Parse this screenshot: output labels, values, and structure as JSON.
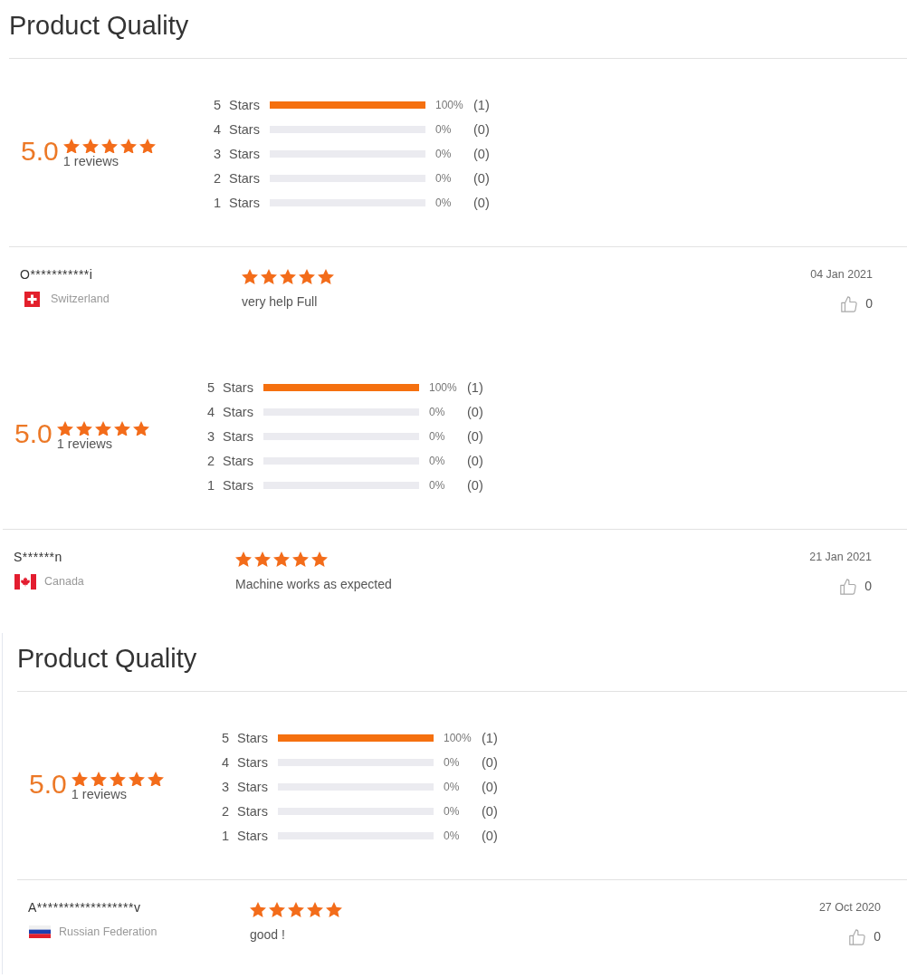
{
  "sections": [
    {
      "title": "Product Quality",
      "summary": {
        "score": "5.0",
        "stars": 5,
        "review_count": "1 reviews",
        "distribution": [
          {
            "label": "5 Stars",
            "level": 1,
            "percent": "100%",
            "count": "(1)"
          },
          {
            "label": "4 Stars",
            "level": 0,
            "percent": "0%",
            "count": "(0)"
          },
          {
            "label": "3 Stars",
            "level": 0,
            "percent": "0%",
            "count": "(0)"
          },
          {
            "label": "2 Stars",
            "level": 0,
            "percent": "0%",
            "count": "(0)"
          },
          {
            "label": "1 Stars",
            "level": 0,
            "percent": "0%",
            "count": "(0)"
          }
        ]
      },
      "reviews": [
        {
          "name": "O***********i",
          "flag": {
            "kind": "ch"
          },
          "country": "Switzerland",
          "stars": 5,
          "text": "very help Full",
          "date": "04 Jan 2021",
          "likes": "0"
        }
      ]
    },
    {
      "summary": {
        "score": "5.0",
        "stars": 5,
        "review_count": "1 reviews",
        "distribution": [
          {
            "label": "5 Stars",
            "level": 1,
            "percent": "100%",
            "count": "(1)"
          },
          {
            "label": "4 Stars",
            "level": 0,
            "percent": "0%",
            "count": "(0)"
          },
          {
            "label": "3 Stars",
            "level": 0,
            "percent": "0%",
            "count": "(0)"
          },
          {
            "label": "2 Stars",
            "level": 0,
            "percent": "0%",
            "count": "(0)"
          },
          {
            "label": "1 Stars",
            "level": 0,
            "percent": "0%",
            "count": "(0)"
          }
        ]
      },
      "reviews": [
        {
          "name": "S******n",
          "flag": {
            "kind": "ca"
          },
          "country": "Canada",
          "stars": 5,
          "text": "Machine works as expected",
          "date": "21 Jan 2021",
          "likes": "0"
        }
      ]
    },
    {
      "title": "Product Quality",
      "summary": {
        "score": "5.0",
        "stars": 5,
        "review_count": "1 reviews",
        "distribution": [
          {
            "label": "5 Stars",
            "level": 1,
            "percent": "100%",
            "count": "(1)"
          },
          {
            "label": "4 Stars",
            "level": 0,
            "percent": "0%",
            "count": "(0)"
          },
          {
            "label": "3 Stars",
            "level": 0,
            "percent": "0%",
            "count": "(0)"
          },
          {
            "label": "2 Stars",
            "level": 0,
            "percent": "0%",
            "count": "(0)"
          },
          {
            "label": "1 Stars",
            "level": 0,
            "percent": "0%",
            "count": "(0)"
          }
        ]
      },
      "reviews": [
        {
          "name": "A******************v",
          "flag": {
            "kind": "ru"
          },
          "country": "Russian Federation",
          "stars": 5,
          "text": "good !",
          "date": "27 Oct 2020",
          "likes": "0"
        }
      ]
    }
  ]
}
